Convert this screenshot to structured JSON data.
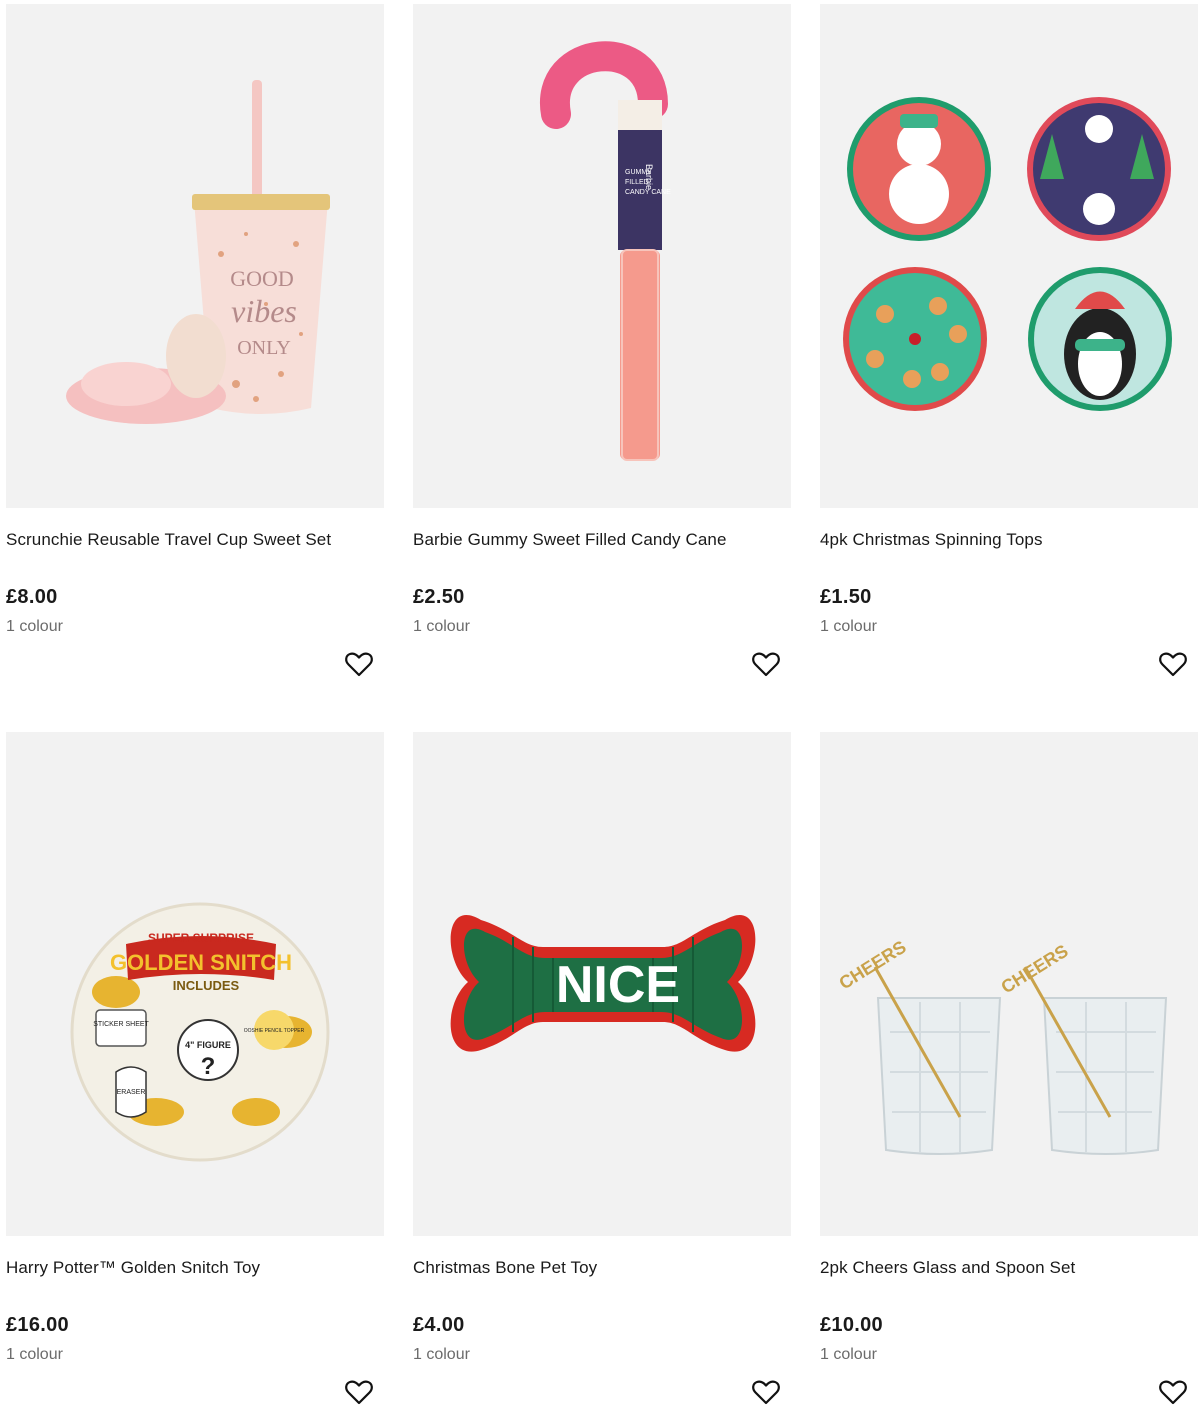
{
  "products": [
    {
      "title": "Scrunchie Reusable Travel Cup Sweet Set",
      "price": "£8.00",
      "colours": "1 colour",
      "image_text": [
        "GOOD",
        "vibes",
        "ONLY"
      ]
    },
    {
      "title": "Barbie Gummy Sweet Filled Candy Cane",
      "price": "£2.50",
      "colours": "1 colour",
      "image_text": [
        "Barbie",
        "GUMMY",
        "FILLED",
        "CANDY CANE"
      ]
    },
    {
      "title": "4pk Christmas Spinning Tops",
      "price": "£1.50",
      "colours": "1 colour",
      "image_text": []
    },
    {
      "title": "Harry Potter™ Golden Snitch Toy",
      "price": "£16.00",
      "colours": "1 colour",
      "image_text": [
        "SUPER SURPRISE",
        "GOLDEN SNITCH",
        "INCLUDES",
        "STICKER SHEET",
        "4\" FIGURE",
        "OOSHIE PENCIL TOPPER",
        "ERASER"
      ]
    },
    {
      "title": "Christmas Bone Pet Toy",
      "price": "£4.00",
      "colours": "1 colour",
      "image_text": [
        "NICE"
      ]
    },
    {
      "title": "2pk Cheers Glass and Spoon Set",
      "price": "£10.00",
      "colours": "1 colour",
      "image_text": [
        "CHEERS",
        "CHEERS"
      ]
    }
  ],
  "icons": {
    "favourite": "heart-outline-icon"
  },
  "colors": {
    "card_bg": "#f2f2f2",
    "price_text": "#1a1a1a",
    "muted_text": "#6b6b6b"
  }
}
